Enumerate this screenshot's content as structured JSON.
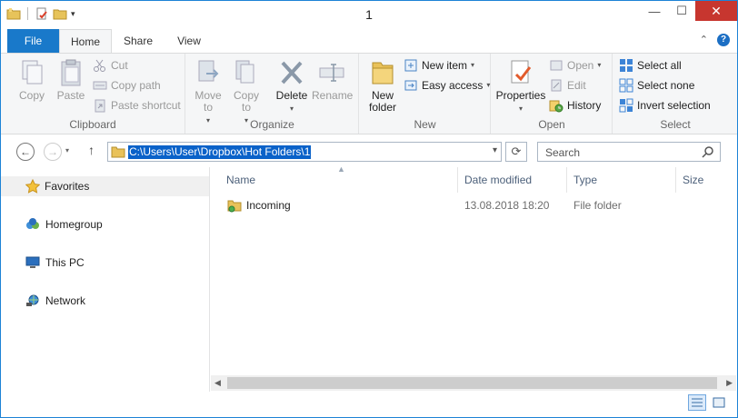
{
  "window": {
    "title": "1"
  },
  "tabs": {
    "file": "File",
    "home": "Home",
    "share": "Share",
    "view": "View"
  },
  "ribbon": {
    "clipboard": {
      "label": "Clipboard",
      "copy": "Copy",
      "paste": "Paste",
      "cut": "Cut",
      "copy_path": "Copy path",
      "paste_shortcut": "Paste shortcut"
    },
    "organize": {
      "label": "Organize",
      "move_to": "Move to",
      "copy_to": "Copy to",
      "delete": "Delete",
      "rename": "Rename"
    },
    "new": {
      "label": "New",
      "new_folder": "New folder",
      "new_item": "New item",
      "easy_access": "Easy access"
    },
    "open": {
      "label": "Open",
      "properties": "Properties",
      "open": "Open",
      "edit": "Edit",
      "history": "History"
    },
    "select": {
      "label": "Select",
      "select_all": "Select all",
      "select_none": "Select none",
      "invert_selection": "Invert selection"
    }
  },
  "address": {
    "path": "C:\\Users\\User\\Dropbox\\Hot Folders\\1"
  },
  "search": {
    "placeholder": "Search"
  },
  "navpane": {
    "favorites": "Favorites",
    "homegroup": "Homegroup",
    "this_pc": "This PC",
    "network": "Network"
  },
  "columns": {
    "name": "Name",
    "date_modified": "Date modified",
    "type": "Type",
    "size": "Size"
  },
  "files": [
    {
      "name": "Incoming",
      "date_modified": "13.08.2018 18:20",
      "type": "File folder"
    }
  ]
}
